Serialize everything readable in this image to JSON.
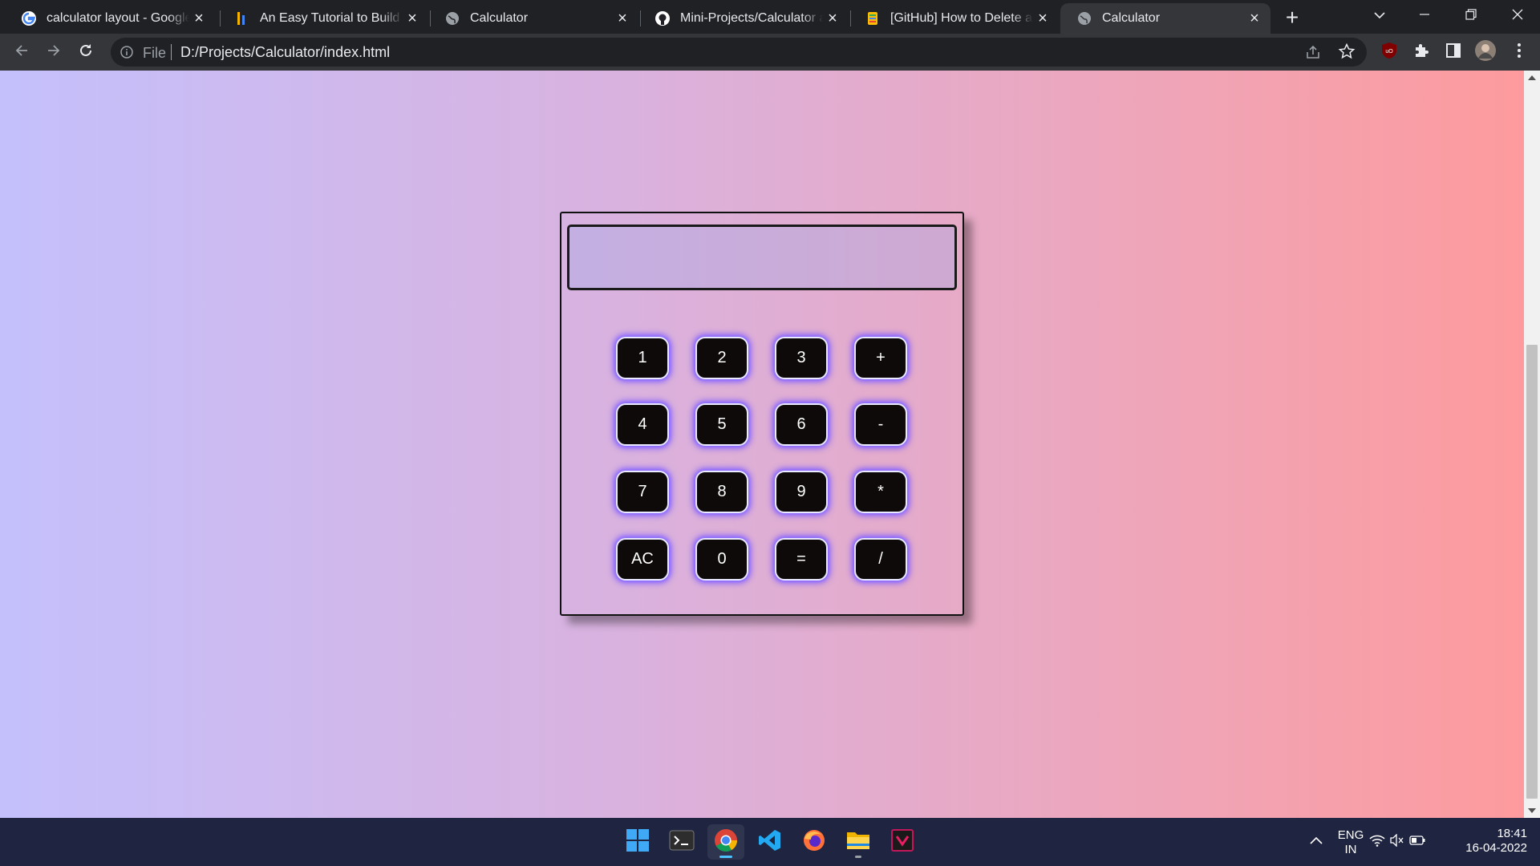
{
  "browser": {
    "tabs": [
      {
        "title": "calculator layout - Google S",
        "favicon": "google-icon",
        "active": false
      },
      {
        "title": "An Easy Tutorial to Build A C",
        "favicon": "tutorial-site-icon",
        "active": false
      },
      {
        "title": "Calculator",
        "favicon": "globe-icon",
        "active": false
      },
      {
        "title": "Mini-Projects/Calculator at m",
        "favicon": "github-icon",
        "active": false
      },
      {
        "title": "[GitHub] How to Delete a Re",
        "favicon": "article-icon",
        "active": false
      },
      {
        "title": "Calculator",
        "favicon": "globe-icon",
        "active": true
      }
    ],
    "address": {
      "scheme_label": "File",
      "url": "D:/Projects/Calculator/index.html"
    }
  },
  "calculator": {
    "display_value": "",
    "buttons": [
      "1",
      "2",
      "3",
      "+",
      "4",
      "5",
      "6",
      "-",
      "7",
      "8",
      "9",
      "*",
      "AC",
      "0",
      "=",
      "/"
    ]
  },
  "taskbar": {
    "apps": [
      "windows-start-icon",
      "terminal-icon",
      "chrome-icon",
      "vscode-icon",
      "firefox-icon",
      "file-explorer-icon",
      "app-icon"
    ],
    "language": "ENG",
    "region": "IN",
    "time": "18:41",
    "date": "16-04-2022"
  },
  "colors": {
    "page_gradient_left": "#c4c0fc",
    "page_gradient_right": "#fe9a9c",
    "button_bg": "#0f0a0a",
    "button_glow": "#7f5bff",
    "taskbar_bg": "#1f2440"
  }
}
